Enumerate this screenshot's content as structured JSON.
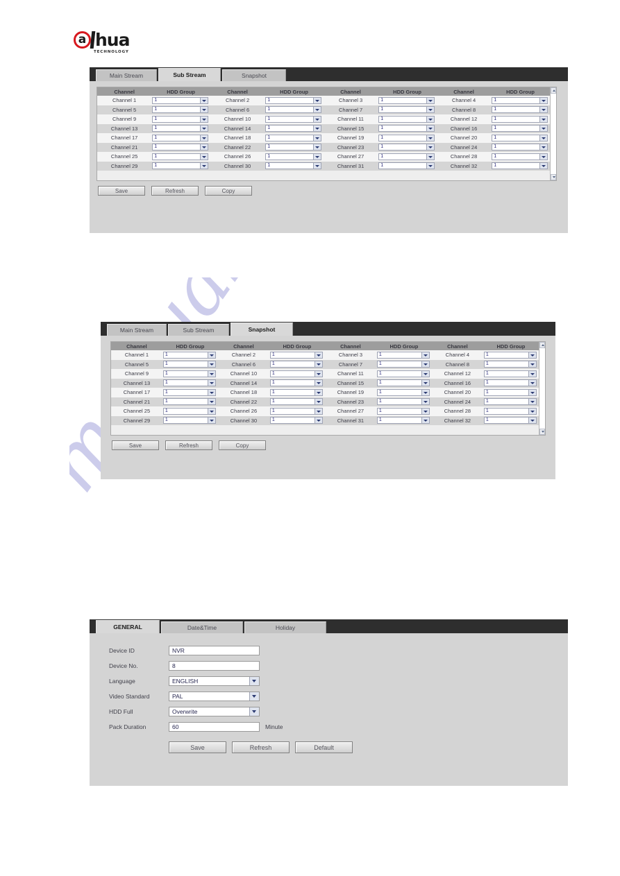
{
  "logo": {
    "mark_letter": "a",
    "wordmark": "hua",
    "tagline": "TECHNOLOGY",
    "brand_red": "#d7191f",
    "brand_black": "#1b1b1b"
  },
  "watermark": {
    "text": "manualshive.com",
    "color": "#b9b9e4"
  },
  "panels": [
    {
      "id": "sub-stream-panel",
      "tabs": [
        {
          "label": "Main Stream",
          "active": false
        },
        {
          "label": "Sub Stream",
          "active": true
        },
        {
          "label": "Snapshot",
          "active": false
        }
      ],
      "table": {
        "headers": [
          "Channel",
          "HDD Group",
          "Channel",
          "HDD Group",
          "Channel",
          "HDD Group",
          "Channel",
          "HDD Group"
        ],
        "rows": [
          [
            {
              "channel": "Channel 1",
              "group": "1"
            },
            {
              "channel": "Channel 2",
              "group": "1"
            },
            {
              "channel": "Channel 3",
              "group": "1"
            },
            {
              "channel": "Channel 4",
              "group": "1"
            }
          ],
          [
            {
              "channel": "Channel 5",
              "group": "1"
            },
            {
              "channel": "Channel 6",
              "group": "1"
            },
            {
              "channel": "Channel 7",
              "group": "1"
            },
            {
              "channel": "Channel 8",
              "group": "1"
            }
          ],
          [
            {
              "channel": "Channel 9",
              "group": "1"
            },
            {
              "channel": "Channel 10",
              "group": "1"
            },
            {
              "channel": "Channel 11",
              "group": "1"
            },
            {
              "channel": "Channel 12",
              "group": "1"
            }
          ],
          [
            {
              "channel": "Channel 13",
              "group": "1"
            },
            {
              "channel": "Channel 14",
              "group": "1"
            },
            {
              "channel": "Channel 15",
              "group": "1"
            },
            {
              "channel": "Channel 16",
              "group": "1"
            }
          ],
          [
            {
              "channel": "Channel 17",
              "group": "1"
            },
            {
              "channel": "Channel 18",
              "group": "1"
            },
            {
              "channel": "Channel 19",
              "group": "1"
            },
            {
              "channel": "Channel 20",
              "group": "1"
            }
          ],
          [
            {
              "channel": "Channel 21",
              "group": "1"
            },
            {
              "channel": "Channel 22",
              "group": "1"
            },
            {
              "channel": "Channel 23",
              "group": "1"
            },
            {
              "channel": "Channel 24",
              "group": "1"
            }
          ],
          [
            {
              "channel": "Channel 25",
              "group": "1"
            },
            {
              "channel": "Channel 26",
              "group": "1"
            },
            {
              "channel": "Channel 27",
              "group": "1"
            },
            {
              "channel": "Channel 28",
              "group": "1"
            }
          ],
          [
            {
              "channel": "Channel 29",
              "group": "1"
            },
            {
              "channel": "Channel 30",
              "group": "1"
            },
            {
              "channel": "Channel 31",
              "group": "1"
            },
            {
              "channel": "Channel 32",
              "group": "1"
            }
          ]
        ]
      },
      "buttons": [
        "Save",
        "Refresh",
        "Copy"
      ]
    },
    {
      "id": "snapshot-panel",
      "tabs": [
        {
          "label": "Main Stream",
          "active": false
        },
        {
          "label": "Sub Stream",
          "active": false
        },
        {
          "label": "Snapshot",
          "active": true
        }
      ],
      "table": {
        "headers": [
          "Channel",
          "HDD Group",
          "Channel",
          "HDD Group",
          "Channel",
          "HDD Group",
          "Channel",
          "HDD Group"
        ],
        "rows": [
          [
            {
              "channel": "Channel 1",
              "group": "1"
            },
            {
              "channel": "Channel 2",
              "group": "1"
            },
            {
              "channel": "Channel 3",
              "group": "1"
            },
            {
              "channel": "Channel 4",
              "group": "1"
            }
          ],
          [
            {
              "channel": "Channel 5",
              "group": "1"
            },
            {
              "channel": "Channel 6",
              "group": "1"
            },
            {
              "channel": "Channel 7",
              "group": "1"
            },
            {
              "channel": "Channel 8",
              "group": "1"
            }
          ],
          [
            {
              "channel": "Channel 9",
              "group": "1"
            },
            {
              "channel": "Channel 10",
              "group": "1"
            },
            {
              "channel": "Channel 11",
              "group": "1"
            },
            {
              "channel": "Channel 12",
              "group": "1"
            }
          ],
          [
            {
              "channel": "Channel 13",
              "group": "1"
            },
            {
              "channel": "Channel 14",
              "group": "1"
            },
            {
              "channel": "Channel 15",
              "group": "1"
            },
            {
              "channel": "Channel 16",
              "group": "1"
            }
          ],
          [
            {
              "channel": "Channel 17",
              "group": "1"
            },
            {
              "channel": "Channel 18",
              "group": "1"
            },
            {
              "channel": "Channel 19",
              "group": "1"
            },
            {
              "channel": "Channel 20",
              "group": "1"
            }
          ],
          [
            {
              "channel": "Channel 21",
              "group": "1"
            },
            {
              "channel": "Channel 22",
              "group": "1"
            },
            {
              "channel": "Channel 23",
              "group": "1"
            },
            {
              "channel": "Channel 24",
              "group": "1"
            }
          ],
          [
            {
              "channel": "Channel 25",
              "group": "1"
            },
            {
              "channel": "Channel 26",
              "group": "1"
            },
            {
              "channel": "Channel 27",
              "group": "1"
            },
            {
              "channel": "Channel 28",
              "group": "1"
            }
          ],
          [
            {
              "channel": "Channel 29",
              "group": "1"
            },
            {
              "channel": "Channel 30",
              "group": "1"
            },
            {
              "channel": "Channel 31",
              "group": "1"
            },
            {
              "channel": "Channel 32",
              "group": "1"
            }
          ]
        ]
      },
      "buttons": [
        "Save",
        "Refresh",
        "Copy"
      ]
    },
    {
      "id": "general-panel",
      "tabs": [
        {
          "label": "GENERAL",
          "active": true
        },
        {
          "label": "Date&Time",
          "active": false
        },
        {
          "label": "Holiday",
          "active": false
        }
      ],
      "form": {
        "fields": [
          {
            "label": "Device ID",
            "value": "NVR",
            "type": "text",
            "unit": ""
          },
          {
            "label": "Device No.",
            "value": "8",
            "type": "text",
            "unit": ""
          },
          {
            "label": "Language",
            "value": "ENGLISH",
            "type": "select",
            "unit": ""
          },
          {
            "label": "Video Standard",
            "value": "PAL",
            "type": "select",
            "unit": ""
          },
          {
            "label": "HDD Full",
            "value": "Overwrite",
            "type": "select",
            "unit": ""
          },
          {
            "label": "Pack Duration",
            "value": "60",
            "type": "text",
            "unit": "Minute"
          }
        ]
      },
      "buttons": [
        "Save",
        "Refresh",
        "Default"
      ]
    }
  ]
}
